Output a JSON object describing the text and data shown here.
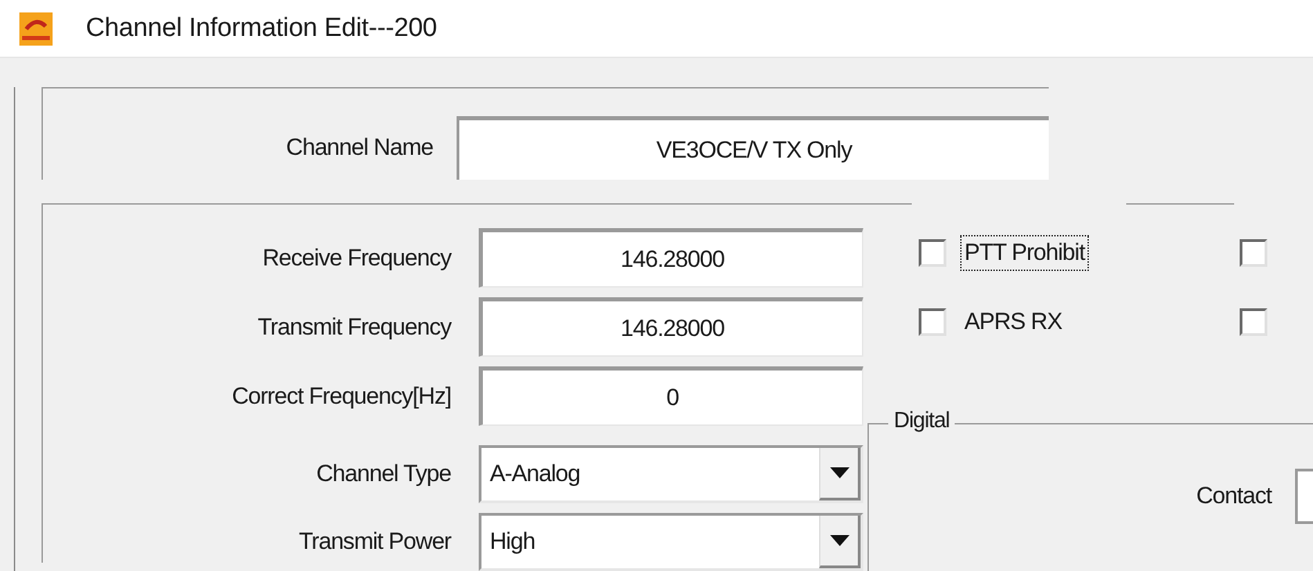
{
  "window": {
    "title": "Channel Information Edit---200"
  },
  "channel_name": {
    "label": "Channel Name",
    "value": "VE3OCE/V TX Only"
  },
  "fields": [
    {
      "kind": "text",
      "label": "Receive Frequency",
      "value": "146.28000"
    },
    {
      "kind": "text",
      "label": "Transmit Frequency",
      "value": "146.28000"
    },
    {
      "kind": "text",
      "label": "Correct Frequency[Hz]",
      "value": "0"
    },
    {
      "kind": "dropdown",
      "label": "Channel Type",
      "value": "A-Analog"
    },
    {
      "kind": "dropdown",
      "label": "Transmit Power",
      "value": "High"
    }
  ],
  "checkboxes": [
    {
      "label": "PTT Prohibit",
      "checked": false,
      "focused": true
    },
    {
      "label": "APRS RX",
      "checked": false,
      "focused": false
    }
  ],
  "checkboxes_column_2": [
    {
      "checked": false
    },
    {
      "checked": false
    }
  ],
  "digital": {
    "title": "Digital",
    "fields": [
      {
        "label": "Contact"
      }
    ]
  }
}
